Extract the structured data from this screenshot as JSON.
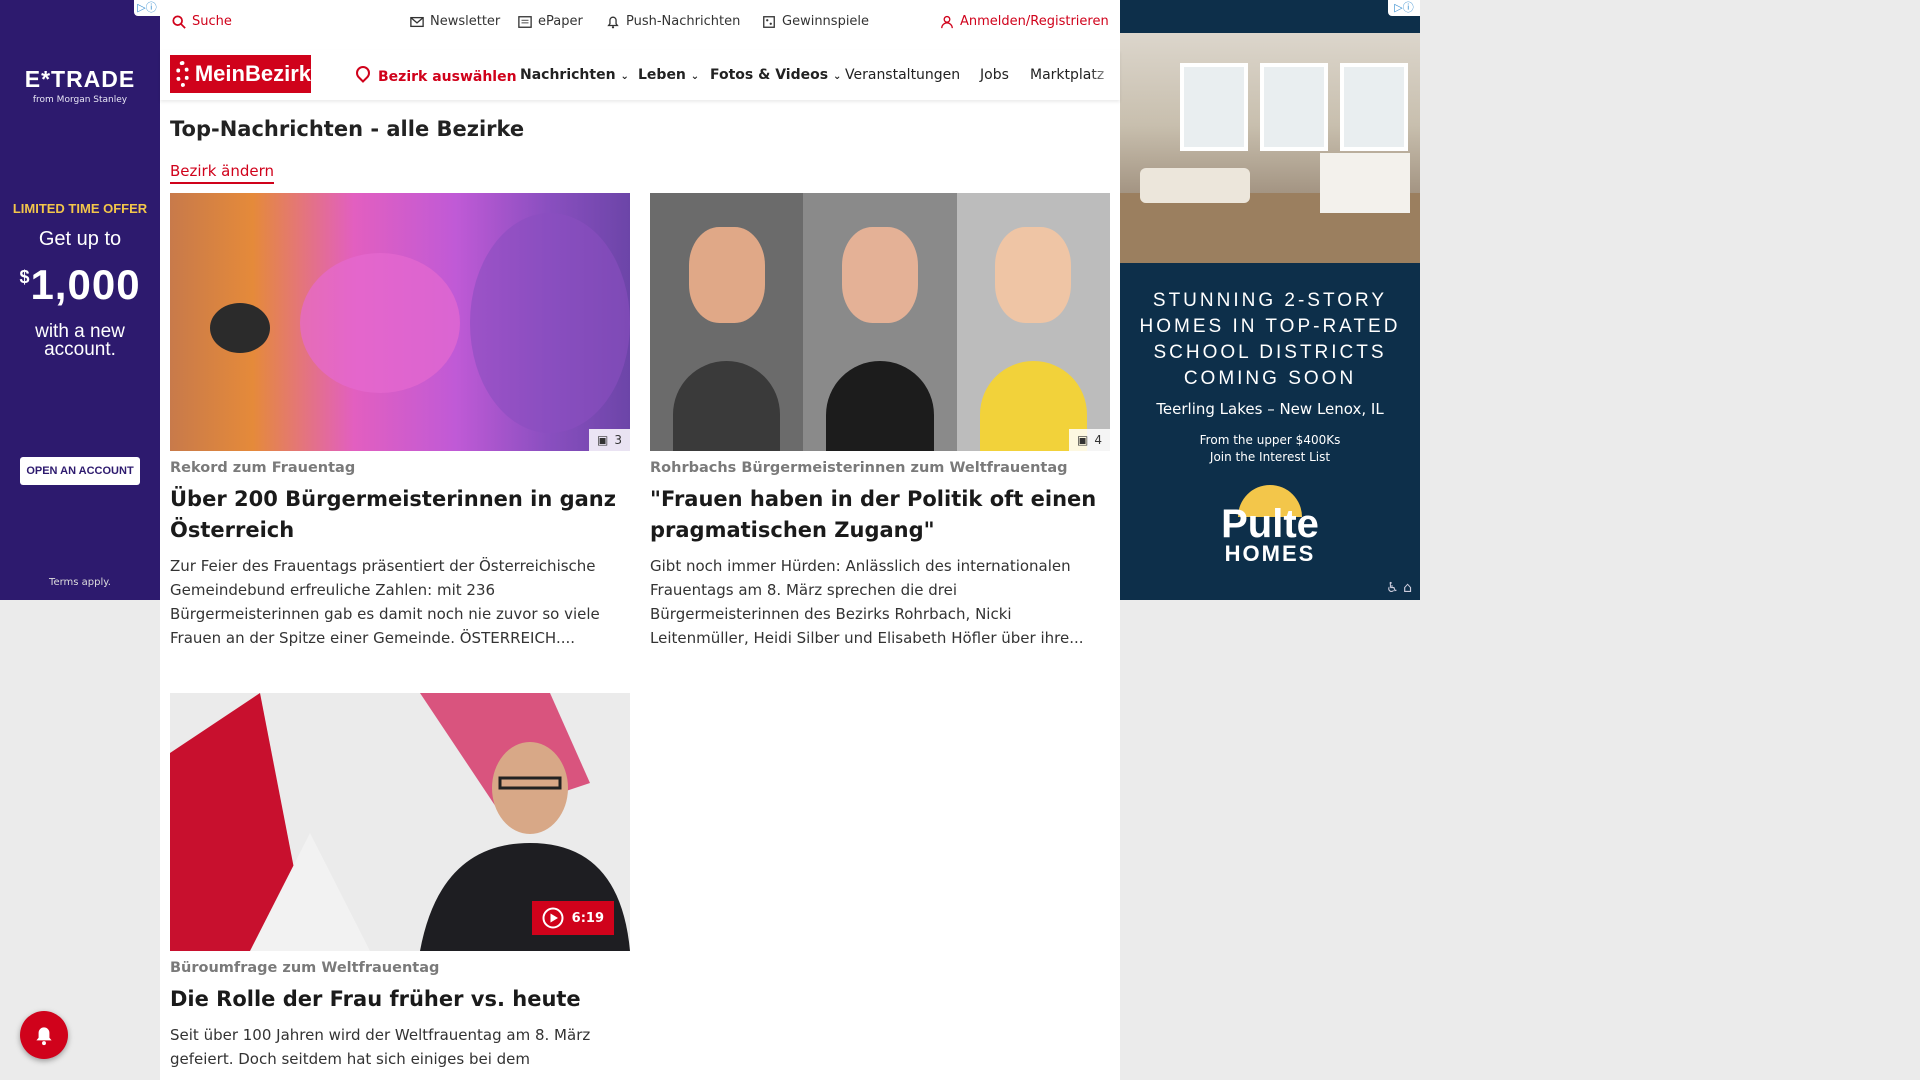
{
  "colors": {
    "accent": "#d0021b",
    "muted": "#7a7a7a"
  },
  "ad_left": {
    "brand": "E*TRADE",
    "brand_sub": "from Morgan Stanley",
    "offer": "LIMITED TIME OFFER",
    "get_up_to": "Get up to",
    "currency": "$",
    "amount": "1,000",
    "with_new": "with a new account.",
    "cta": "OPEN AN ACCOUNT",
    "terms": "Terms apply."
  },
  "ad_right": {
    "headline_1": "STUNNING 2-STORY",
    "headline_2": "HOMES IN TOP-RATED",
    "headline_3": "SCHOOL DISTRICTS",
    "headline_4": "COMING SOON",
    "location": "Teerling Lakes – New Lenox, IL",
    "price": "From the upper $400Ks",
    "cta": "Join the Interest List",
    "logo_1": "Pulte",
    "logo_2": "HOMES"
  },
  "topbar": {
    "search": "Suche",
    "newsletter": "Newsletter",
    "epaper": "ePaper",
    "push": "Push-Nachrichten",
    "gewinnspiele": "Gewinnspiele",
    "login": "Anmelden/Registrieren"
  },
  "nav": {
    "logo": "MeinBezirk",
    "district": "Bezirk auswählen",
    "items": [
      "Nachrichten",
      "Leben",
      "Fotos & Videos",
      "Veranstaltungen",
      "Jobs",
      "Marktplatz"
    ]
  },
  "section": {
    "title": "Top-Nachrichten - alle Bezirke",
    "change": "Bezirk ändern"
  },
  "articles": [
    {
      "kicker": "Rekord zum Frauentag",
      "headline": "Über 200 Bürgermeisterinnen in ganz Österreich",
      "teaser": "Zur Feier des Frauentags präsentiert der Österreichische Gemeindebund erfreuliche Zahlen: mit 236 Bürgermeisterinnen gab es damit noch nie zuvor so viele Frauen an der Spitze einer Gemeinde. ÖSTERREICH....",
      "photo_count": "3"
    },
    {
      "kicker": "Rohrbachs Bürgermeisterinnen zum Weltfrauentag",
      "headline": "\"Frauen haben in der Politik oft einen pragmatischen Zugang\"",
      "teaser": "Gibt noch immer Hürden: Anlässlich des internationalen Frauentags am 8. März sprechen die drei Bürgermeisterinnen des Bezirks Rohrbach, Nicki Leitenmüller, Heidi Silber und Elisabeth Höfler über ihre...",
      "photo_count": "4"
    },
    {
      "kicker": "Büroumfrage zum Weltfrauentag",
      "headline": "Die Rolle der Frau früher vs. heute",
      "teaser": "Seit über 100 Jahren wird der Weltfrauentag am 8. März gefeiert. Doch seitdem hat sich einiges bei dem",
      "video_duration": "6:19"
    }
  ]
}
